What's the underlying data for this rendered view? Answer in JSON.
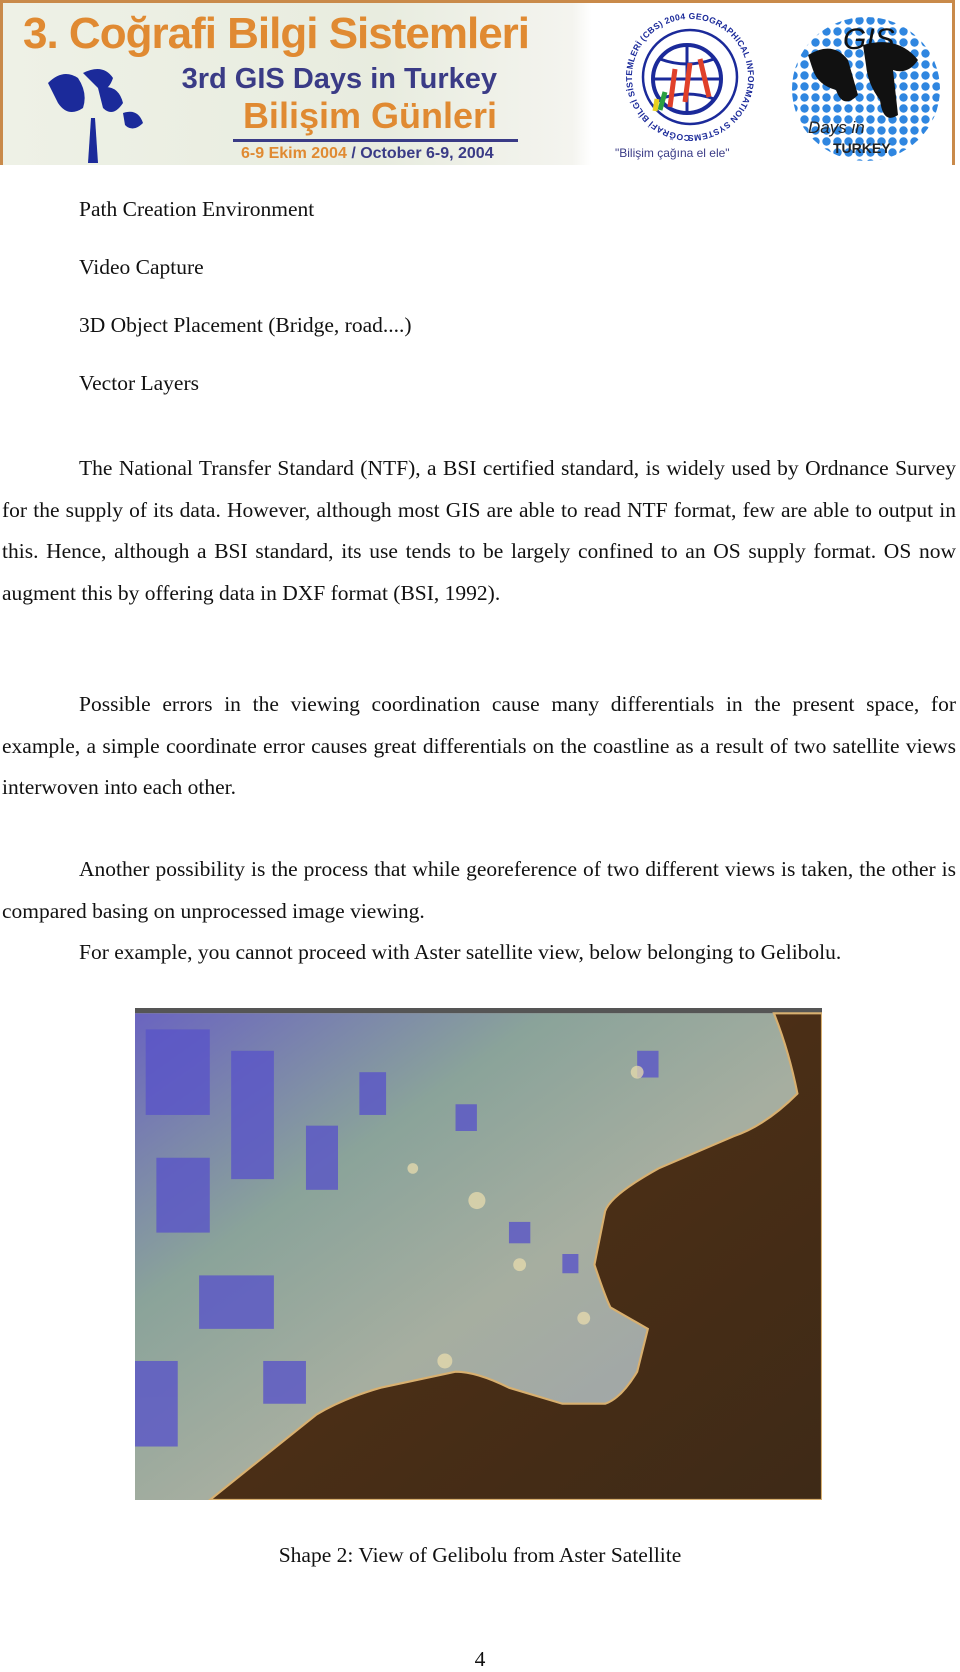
{
  "banner": {
    "title": "3. Coğrafi Bilgi Sistemleri",
    "subtitle_en": "3rd GIS Days in Turkey",
    "subtitle_tr": "Bilişim Günleri",
    "date_tr": "6-9 Ekim 2004",
    "date_en": "/ October 6-9, 2004",
    "logo1_text": "COĞRAFİ BİLGİ SİSTEMLERİ (CBS) 2004 GEOGRAPHICAL INFORMATION SYSTEMS",
    "slogan": "\"Bilişim çağına el ele\"",
    "logo2_text": "GIS Days in TURKEY",
    "colors": {
      "orange": "#e08a32",
      "navy": "#3a3b86",
      "border": "#c98a4a"
    }
  },
  "list_items": [
    "Path Creation Environment",
    "Video Capture",
    "3D Object Placement (Bridge, road....)",
    "Vector Layers"
  ],
  "paragraphs": [
    "The National Transfer Standard (NTF), a BSI certified standard, is widely used by Ordnance Survey for the supply of its data. However, although most GIS are able to read NTF format, few are able to output in this. Hence, although a BSI standard, its use tends to be largely confined to an OS supply format. OS now augment this by offering data in DXF format (BSI, 1992).",
    "Possible errors in the viewing coordination cause many differentials in the present space, for example, a simple coordinate error causes great differentials on the coastline as a result of two satellite views interwoven into each other.",
    "Another possibility is the process that while georeference of two different views is taken, the other is compared basing on unprocessed image viewing."
  ],
  "example_line": "For example, you cannot proceed with Aster satellite view, below belonging to Gelibolu.",
  "figure": {
    "caption": "Shape 2: View of Gelibolu from Aster Satellite"
  },
  "page_number": "4"
}
